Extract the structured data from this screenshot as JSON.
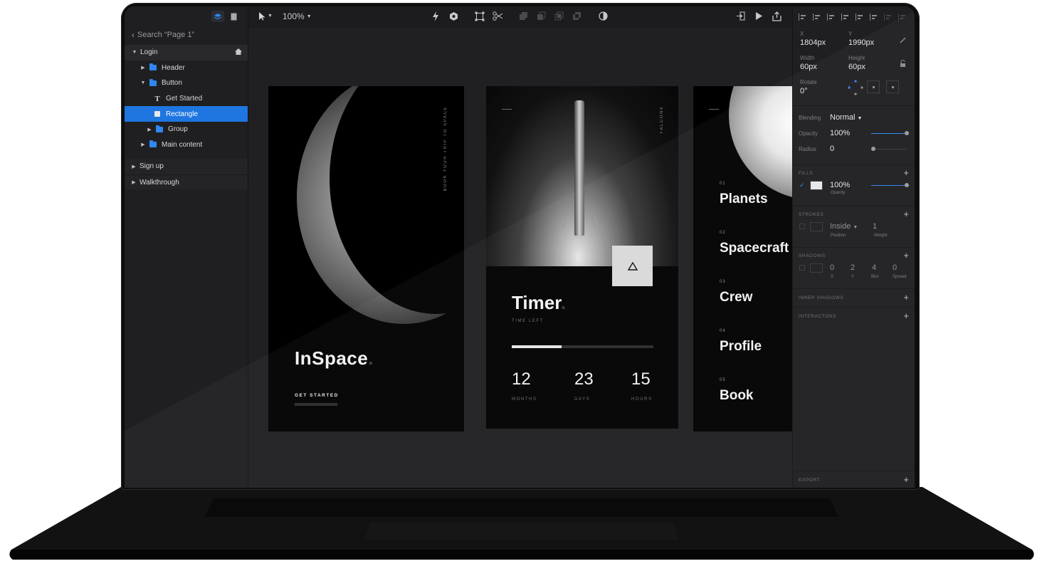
{
  "layers_panel": {
    "search_text": "Search “Page 1”",
    "tree": [
      {
        "label": "Login"
      },
      {
        "label": "Header"
      },
      {
        "label": "Button"
      },
      {
        "label": "Get Started"
      },
      {
        "label": "Rectangle"
      },
      {
        "label": "Group"
      },
      {
        "label": "Main content"
      },
      {
        "label": "Sign up"
      },
      {
        "label": "Walkthrough"
      }
    ]
  },
  "toolbar": {
    "zoom": "100%"
  },
  "artboards": {
    "inspace": {
      "vertical_text": "BOOK YOUR TRIP TO SPACE",
      "title": "InSpace",
      "title_dot": ".",
      "cta": "GET STARTED"
    },
    "timer": {
      "vertical_text": "FALCON9",
      "title": "Timer",
      "title_dot": ".",
      "subtitle": "TIME LEFT",
      "progress": 0.35,
      "stats": [
        {
          "value": "12",
          "label": "MONTHS"
        },
        {
          "value": "23",
          "label": "DAYS"
        },
        {
          "value": "15",
          "label": "HOURS"
        }
      ]
    },
    "menu": {
      "items": [
        {
          "num": "01",
          "label": "Planets"
        },
        {
          "num": "02",
          "label": "Spacecraft"
        },
        {
          "num": "03",
          "label": "Crew"
        },
        {
          "num": "04",
          "label": "Profile"
        },
        {
          "num": "05",
          "label": "Book"
        }
      ]
    }
  },
  "inspector": {
    "x_label": "X",
    "x_value": "1804px",
    "y_label": "Y",
    "y_value": "1990px",
    "width_label": "Width",
    "width_value": "60px",
    "height_label": "Height",
    "height_value": "60px",
    "rotate_label": "Rotate",
    "rotate_value": "0°",
    "blending_label": "Blending",
    "blending_value": "Normal",
    "opacity_label": "Opacity",
    "opacity_value": "100%",
    "radius_label": "Radius",
    "radius_value": "0",
    "fills_header": "FILLS",
    "fill_opacity": "100%",
    "fill_opacity_label": "Opacity",
    "strokes_header": "STROKES",
    "stroke_position": "Inside",
    "stroke_position_label": "Position",
    "stroke_weight": "1",
    "stroke_weight_label": "Weight",
    "shadows_header": "SHADOWS",
    "shadow": [
      {
        "value": "0",
        "label": "X"
      },
      {
        "value": "2",
        "label": "Y"
      },
      {
        "value": "4",
        "label": "Blur"
      },
      {
        "value": "0",
        "label": "Spread"
      }
    ],
    "inner_shadows_header": "INNER SHADOWS",
    "interactions_header": "INTERACTONS",
    "export_header": "EXPORT"
  },
  "colors": {
    "accent": "#1f76e0",
    "panel": "#1f1f21",
    "canvas": "#202022"
  }
}
